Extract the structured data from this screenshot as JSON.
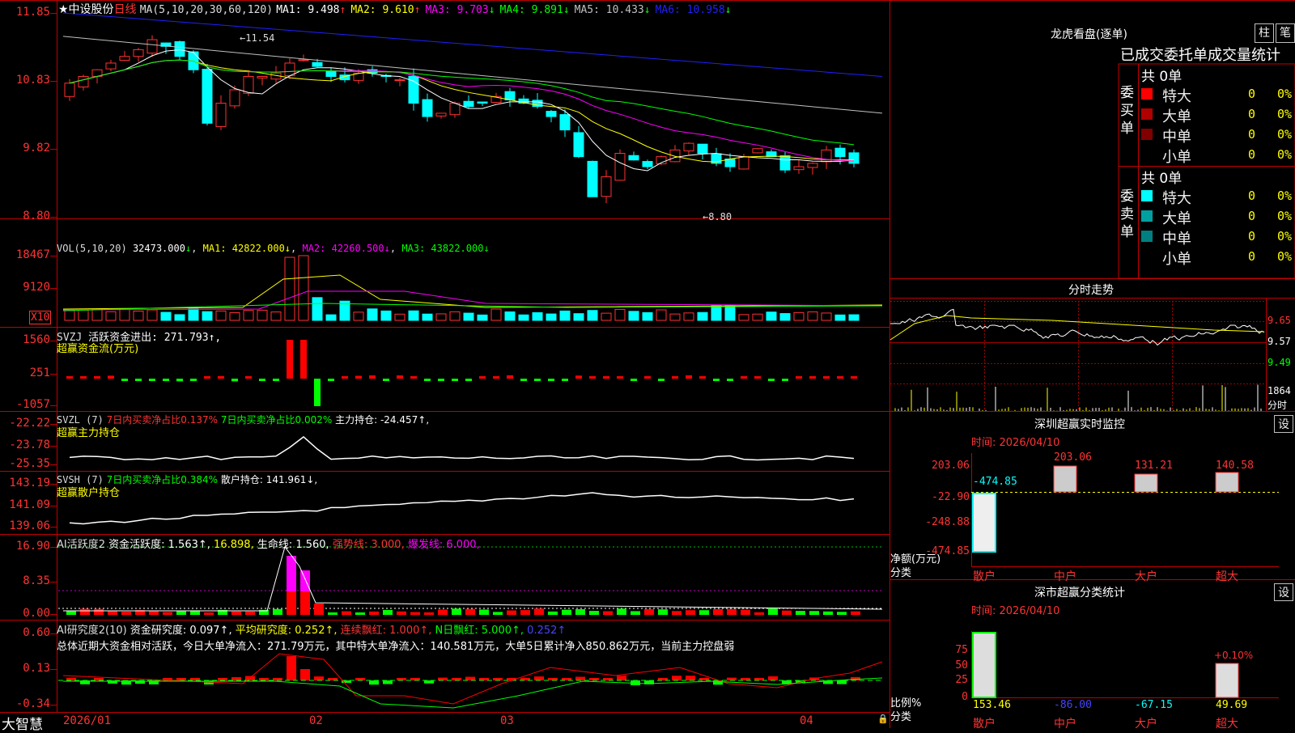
{
  "stock": {
    "name": "★中设股份",
    "period": "日线",
    "ma_prefix": "MA(5,10,20,30,60,120)"
  },
  "ma": [
    {
      "label": "MA1:",
      "value": "9.498",
      "arrow": "↑",
      "color": "#ffffff"
    },
    {
      "label": "MA2:",
      "value": "9.610",
      "arrow": "↑",
      "color": "#ffff00"
    },
    {
      "label": "MA3:",
      "value": "9.703",
      "arrow": "↓",
      "color": "#ff00ff"
    },
    {
      "label": "MA4:",
      "value": "9.891",
      "arrow": "↓",
      "color": "#00ff00"
    },
    {
      "label": "MA5:",
      "value": "10.433",
      "arrow": "↓",
      "color": "#c0c0c0"
    },
    {
      "label": "MA6:",
      "value": "10.958",
      "arrow": "↓",
      "color": "#2020ff"
    }
  ],
  "price_axis": [
    "11.85",
    "10.83",
    "9.82",
    "8.80"
  ],
  "price_marks": {
    "high": "11.54",
    "low": "8.80"
  },
  "vol": {
    "prefix": "VOL(5,10,20)",
    "value": "32473.000",
    "arrow": "↓",
    "ma1": "MA1: 42822.000↓",
    "ma2": "MA2: 42260.500↓",
    "ma3": "MA3: 43822.000↓",
    "axis": [
      "18467",
      "9120"
    ],
    "unit": "X10"
  },
  "svzj": {
    "prefix": "SVZJ",
    "label": "活跃资金进出: 271.793↑,",
    "title": "超赢资金流(万元)",
    "axis": [
      "1560",
      "251",
      "-1057"
    ]
  },
  "svzl": {
    "prefix": "SVZL (7)",
    "t1": "7日内买卖净占比0.137%",
    "t2": "7日内买卖净占比0.002%",
    "t3": "主力持仓: -24.457↑,",
    "title": "超赢主力持仓",
    "axis": [
      "-22.22",
      "-23.78",
      "-25.35"
    ]
  },
  "svsh": {
    "prefix": "SVSH (7)",
    "t1": "7日内买卖净占比0.384%",
    "t2": "散户持仓: 141.961↓,",
    "title": "超赢散户持仓",
    "axis": [
      "143.19",
      "141.09",
      "139.06"
    ]
  },
  "ai1": {
    "prefix": "AI活跃度2",
    "t1": "资金活跃度: 1.563↑,",
    "t2": "16.898,",
    "t3": "生命线: 1.560,",
    "t4": "强势线: 3.000,",
    "t5": "爆发线: 6.000,",
    "axis": [
      "16.90",
      "8.35",
      "0.00"
    ]
  },
  "ai2": {
    "prefix": "AI研究度2(10)",
    "t1": "资金研究度: 0.097↑,",
    "t2": "平均研究度: 0.252↑,",
    "t3": "连续飘红: 1.000↑,",
    "t4": "N日飘红: 5.000↑,",
    "t5": "0.252↑",
    "summary": "总体近期大资金相对活跃，今日大单净流入：271.79万元，其中特大单净流入：140.581万元，大单5日累计净入850.862万元，当前主力控盘弱",
    "axis": [
      "0.60",
      "0.13",
      "-0.34"
    ]
  },
  "dates": [
    "2026/01",
    "02",
    "03",
    "04"
  ],
  "logo": "大智慧",
  "lhb": {
    "title": "龙虎看盘(逐单)",
    "btn1": "柱",
    "btn2": "笔",
    "header": "已成交委托单成交量统计",
    "buy_label": "委买单",
    "sell_label": "委卖单",
    "buy_total": "共 0单",
    "sell_total": "共 0单",
    "buy_rows": [
      {
        "name": "特大",
        "count": "0",
        "pct": "0%",
        "color": "#ff0000"
      },
      {
        "name": "大单",
        "count": "0",
        "pct": "0%",
        "color": "#b00000"
      },
      {
        "name": "中单",
        "count": "0",
        "pct": "0%",
        "color": "#800000"
      },
      {
        "name": "小单",
        "count": "0",
        "pct": "0%",
        "color": "#000000"
      }
    ],
    "sell_rows": [
      {
        "name": "特大",
        "count": "0",
        "pct": "0%",
        "color": "#00ffff"
      },
      {
        "name": "大单",
        "count": "0",
        "pct": "0%",
        "color": "#00a0a0"
      },
      {
        "name": "中单",
        "count": "0",
        "pct": "0%",
        "color": "#008080"
      },
      {
        "name": "小单",
        "count": "0",
        "pct": "0%",
        "color": "#000000"
      }
    ]
  },
  "intraday": {
    "title": "分时走势",
    "axis": [
      "9.65",
      "9.57",
      "9.49"
    ],
    "vol_label": "1864",
    "vol_unit": "分时"
  },
  "monitor": {
    "title": "深圳超赢实时监控",
    "btn": "设",
    "time": "时间: 2026/04/10",
    "axis": [
      "203.06",
      "-22.90",
      "-248.88",
      "-474.85"
    ],
    "ylabel": "净额(万元)",
    "xlabel": "分类",
    "cats": [
      "散户",
      "中户",
      "大户",
      "超大"
    ],
    "values": [
      "-474.85",
      "203.06",
      "131.21",
      "140.58"
    ]
  },
  "classify": {
    "title": "深市超赢分类统计",
    "btn": "设",
    "time": "时间: 2026/04/10",
    "axis": [
      "75",
      "50",
      "25",
      "0"
    ],
    "ylabel": "比例%",
    "xlabel": "分类",
    "top_label": "+0.10%",
    "cats": [
      "散户",
      "中户",
      "大户",
      "超大"
    ],
    "values": [
      "153.46",
      "-86.00",
      "-67.15",
      "49.69"
    ]
  }
}
